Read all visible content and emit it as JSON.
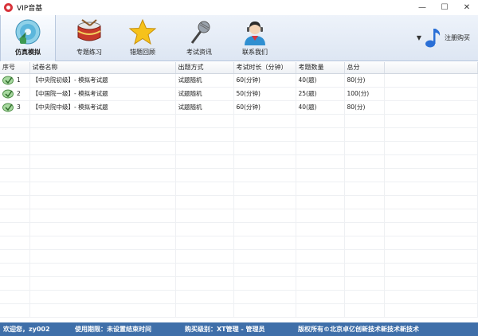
{
  "window": {
    "title": "VIP音基",
    "minimize_label": "—",
    "maximize_label": "☐",
    "close_label": "✕"
  },
  "toolbar": {
    "items": [
      {
        "label": "仿真模拟",
        "icon": "cd-icon",
        "active": true
      },
      {
        "label": "专题练习",
        "icon": "drum-icon",
        "active": false
      },
      {
        "label": "错题回顾",
        "icon": "star-icon",
        "active": false
      },
      {
        "label": "考试资讯",
        "icon": "microphone-icon",
        "active": false
      },
      {
        "label": "联系我们",
        "icon": "person-icon",
        "active": false
      }
    ],
    "register_label": "注册购买",
    "register_icon": "music-note-icon"
  },
  "table": {
    "headers": [
      "序号",
      "试卷名称",
      "出题方式",
      "考试时长（分钟）",
      "考题数量",
      "总分"
    ],
    "rows": [
      {
        "no": "1",
        "name": "【中央院初级】- 模拟考试题",
        "mode": "试题随机",
        "duration": "60(分钟)",
        "count": "40(题)",
        "score": "80(分)"
      },
      {
        "no": "2",
        "name": "【中国院一级】- 模拟考试题",
        "mode": "试题随机",
        "duration": "50(分钟)",
        "count": "25(题)",
        "score": "100(分)"
      },
      {
        "no": "3",
        "name": "【中央院中级】- 模拟考试题",
        "mode": "试题随机",
        "duration": "60(分钟)",
        "count": "40(题)",
        "score": "80(分)"
      }
    ]
  },
  "status": {
    "welcome": "欢迎您，zy002",
    "period": "使用期限：未设置结束时间",
    "level": "购买级别：XT管理 - 管理员",
    "copyright": "版权所有©北京卓亿创新技术新技术新技术"
  }
}
